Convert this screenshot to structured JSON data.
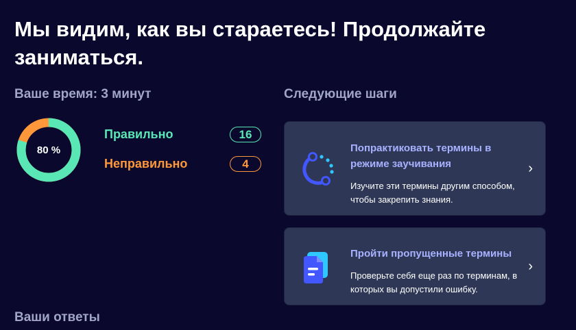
{
  "headline": "Мы видим, как вы стараетесь! Продолжайте заниматься.",
  "time": {
    "label": "Ваше время: 3 минут"
  },
  "result": {
    "percent": 80,
    "percent_text": "80 %",
    "correct_label": "Правильно",
    "correct_count": "16",
    "wrong_label": "Неправильно",
    "wrong_count": "4",
    "colors": {
      "correct": "#59e8b5",
      "wrong": "#ff983a"
    }
  },
  "next_steps": {
    "label": "Следующие шаги",
    "cards": [
      {
        "title": "Попрактиковать термины в режиме заучивания",
        "description": "Изучите эти термины другим способом, чтобы закрепить знания.",
        "icon": "learn-mode-icon"
      },
      {
        "title": "Пройти пропущенные термины",
        "description": "Проверьте себя еще раз по терминам, в которых вы допустили ошибку.",
        "icon": "test-document-icon"
      }
    ]
  },
  "answers": {
    "label": "Ваши ответы"
  }
}
